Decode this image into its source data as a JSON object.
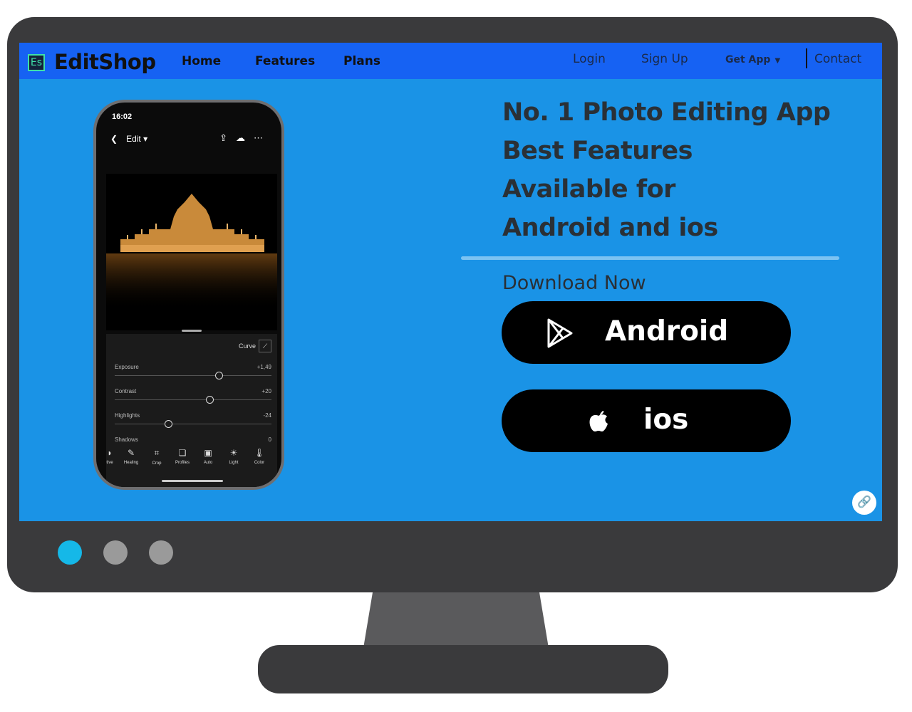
{
  "nav": {
    "logo_icon": "Es",
    "brand": "EditShop",
    "links": [
      "Home",
      "Features",
      "Plans"
    ],
    "right_links": [
      "Login",
      "Sign Up",
      "Get App",
      "Contact"
    ],
    "bg_color": "#1662f3"
  },
  "phone": {
    "status_time": "16:02",
    "edit_label": "Edit",
    "curve_label": "Curve",
    "sliders": [
      {
        "label": "Exposure",
        "value": "+1,49"
      },
      {
        "label": "Contrast",
        "value": "+20"
      },
      {
        "label": "Highlights",
        "value": "-24"
      },
      {
        "label": "Shadows",
        "value": "0"
      }
    ],
    "tools": [
      "tive",
      "Healing",
      "Crop",
      "Profiles",
      "Auto",
      "Light",
      "Color"
    ]
  },
  "hero": {
    "lines": [
      "No. 1 Photo Editing App",
      "Best Features",
      "Available for",
      "Android and ios"
    ],
    "download_label": "Download Now",
    "android_label": "Android",
    "ios_label": "ios",
    "bg_color": "#1a93e6"
  },
  "carousel": {
    "dots": [
      {
        "state": "active",
        "color": "#15b8e8"
      },
      {
        "state": "inactive",
        "color": "#9a9a9a"
      },
      {
        "state": "inactive",
        "color": "#9a9a9a"
      }
    ]
  },
  "icons": {
    "play_store": "play-store-icon",
    "apple": "apple-icon",
    "link": "link-icon"
  }
}
